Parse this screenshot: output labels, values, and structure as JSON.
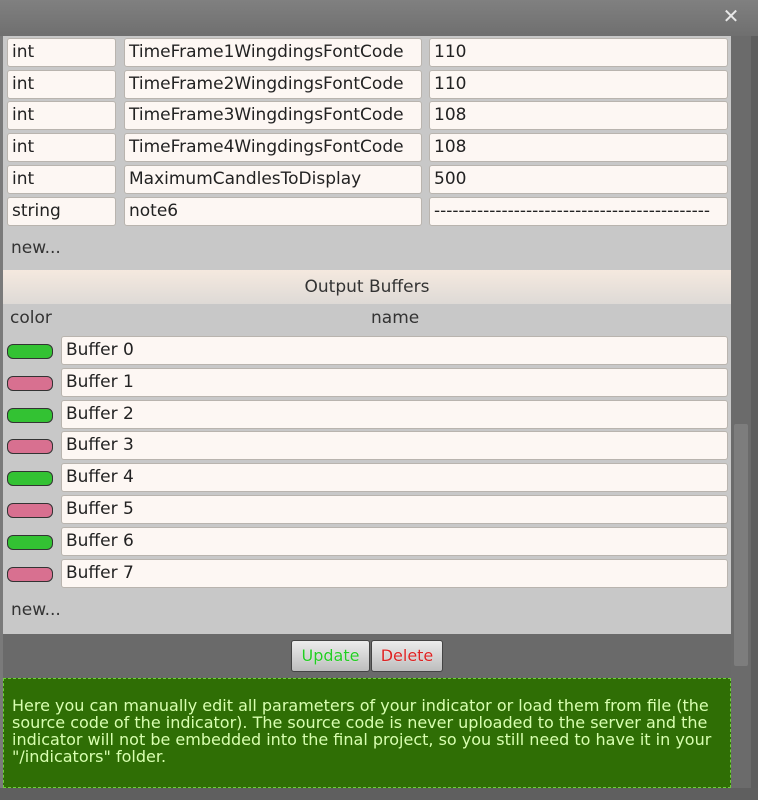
{
  "window": {
    "close_glyph": "✕"
  },
  "parameters": {
    "rows": [
      {
        "type": "int",
        "name": "TimeFrame1WingdingsFontCode",
        "value": "110"
      },
      {
        "type": "int",
        "name": "TimeFrame2WingdingsFontCode",
        "value": "110"
      },
      {
        "type": "int",
        "name": "TimeFrame3WingdingsFontCode",
        "value": "108"
      },
      {
        "type": "int",
        "name": "TimeFrame4WingdingsFontCode",
        "value": "108"
      },
      {
        "type": "int",
        "name": "MaximumCandlesToDisplay",
        "value": "500"
      },
      {
        "type": "string",
        "name": "note6",
        "value": "---------------------------------------------"
      }
    ],
    "new_label": "new..."
  },
  "output_buffers": {
    "title": "Output Buffers",
    "col_color": "color",
    "col_name": "name",
    "rows": [
      {
        "color": "#33c233",
        "name": "Buffer 0"
      },
      {
        "color": "#d87090",
        "name": "Buffer 1"
      },
      {
        "color": "#33c233",
        "name": "Buffer 2"
      },
      {
        "color": "#d87090",
        "name": "Buffer 3"
      },
      {
        "color": "#33c233",
        "name": "Buffer 4"
      },
      {
        "color": "#d87090",
        "name": "Buffer 5"
      },
      {
        "color": "#33c233",
        "name": "Buffer 6"
      },
      {
        "color": "#d87090",
        "name": "Buffer 7"
      }
    ],
    "new_label": "new..."
  },
  "actions": {
    "update_label": "Update",
    "update_color": "#22cc22",
    "delete_label": "Delete",
    "delete_color": "#dd2222"
  },
  "info_text": "Here you can manually edit all parameters of your indicator or load them from file (the source code of the indicator). The source code is never uploaded to the server and the indicator will not be embedded into the final project, so you still need to have it in your \"/indicators\" folder."
}
